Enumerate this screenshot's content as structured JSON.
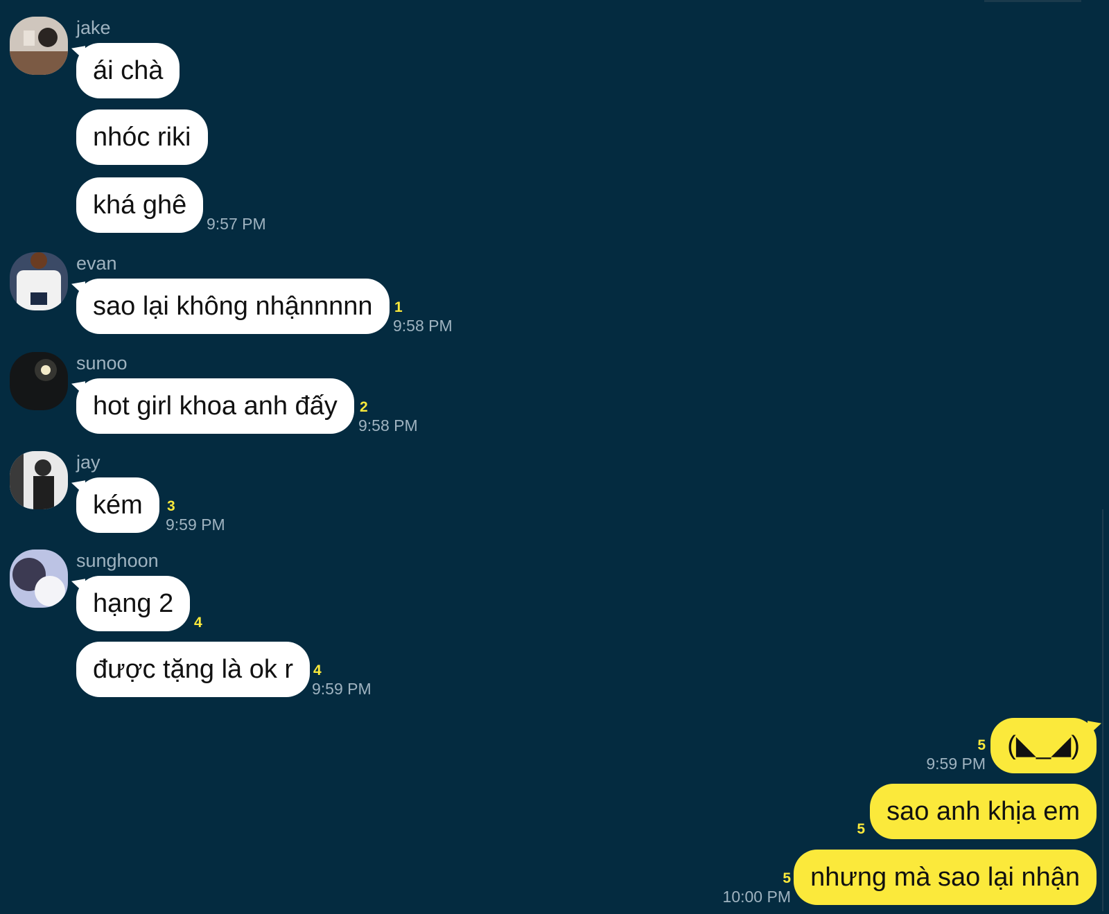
{
  "colors": {
    "background": "#042b40",
    "bubble_other": "#ffffff",
    "bubble_me": "#fbe93b",
    "unread": "#fbe93b",
    "meta_text": "#9fb3c0"
  },
  "messages": [
    {
      "sender": "jake",
      "bubbles": [
        {
          "text": "ái chà"
        },
        {
          "text": "nhóc riki"
        },
        {
          "text": "khá ghê",
          "time": "9:57 PM"
        }
      ]
    },
    {
      "sender": "evan",
      "bubbles": [
        {
          "text": "sao lại không nhậnnnnn",
          "unread": "1",
          "time": "9:58 PM"
        }
      ]
    },
    {
      "sender": "sunoo",
      "bubbles": [
        {
          "text": "hot girl khoa anh đấy",
          "unread": "2",
          "time": "9:58 PM"
        }
      ]
    },
    {
      "sender": "jay",
      "bubbles": [
        {
          "text": "kém",
          "unread": "3",
          "time": "9:59 PM"
        }
      ]
    },
    {
      "sender": "sunghoon",
      "bubbles": [
        {
          "text": "hạng 2",
          "unread": "4"
        },
        {
          "text": "được tặng là ok r",
          "unread": "4",
          "time": "9:59 PM"
        }
      ]
    }
  ],
  "my_messages": [
    {
      "text": "(◣_◢)",
      "unread": "5",
      "time": "9:59 PM"
    },
    {
      "text": "sao anh khịa em",
      "unread": "5"
    },
    {
      "text": "nhưng mà sao lại nhận",
      "unread": "5",
      "time": "10:00 PM"
    }
  ]
}
